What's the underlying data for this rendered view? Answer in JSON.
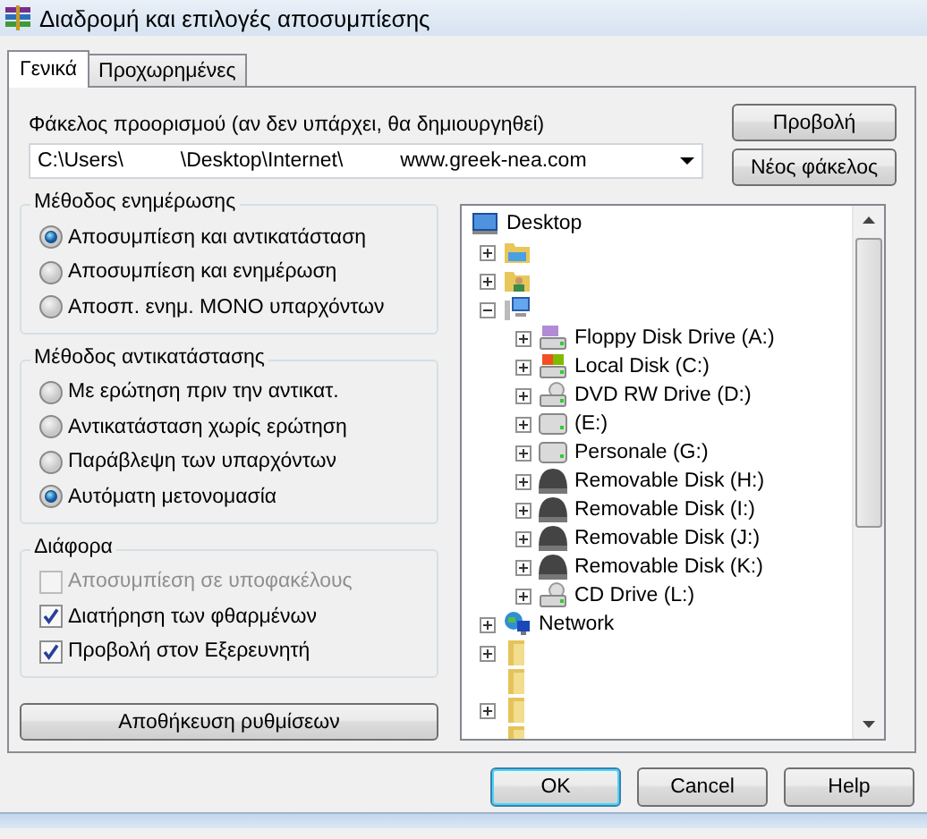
{
  "window": {
    "title": "Διαδρομή και επιλογές αποσυμπίεσης"
  },
  "tabs": [
    {
      "label": "Γενικά",
      "selected": true
    },
    {
      "label": "Προχωρημένες",
      "selected": false
    }
  ],
  "destination": {
    "label": "Φάκελος προορισμού (αν δεν υπάρχει, θα δημιουργηθεί)",
    "value": "C:\\Users\\          \\Desktop\\Internet\\          www.greek-nea.com"
  },
  "side_buttons": [
    "Προβολή",
    "Νέος φάκελος"
  ],
  "groups": [
    {
      "title": "Μέθοδος ενημέρωσης",
      "kind": "radio",
      "items": [
        {
          "label": "Αποσυμπίεση και αντικατάσταση",
          "selected": true
        },
        {
          "label": "Αποσυμπίεση και ενημέρωση",
          "selected": false
        },
        {
          "label": "Αποσπ. ενημ. ΜΟΝΟ υπαρχόντων",
          "selected": false
        }
      ]
    },
    {
      "title": "Μέθοδος αντικατάστασης",
      "kind": "radio",
      "items": [
        {
          "label": "Με ερώτηση πριν την αντικατ.",
          "selected": false
        },
        {
          "label": "Αντικατάσταση χωρίς ερώτηση",
          "selected": false
        },
        {
          "label": "Παράβλεψη των υπαρχόντων",
          "selected": false
        },
        {
          "label": "Αυτόματη μετονομασία",
          "selected": true
        }
      ]
    },
    {
      "title": "Διάφορα",
      "kind": "checkbox",
      "items": [
        {
          "label": "Αποσυμπίεση σε υποφακέλους",
          "checked": false,
          "disabled": true
        },
        {
          "label": "Διατήρηση των φθαρμένων",
          "checked": true,
          "disabled": false
        },
        {
          "label": "Προβολή στον Εξερευνητή",
          "checked": true,
          "disabled": false
        }
      ]
    }
  ],
  "save_button": "Αποθήκευση ρυθμίσεων",
  "tree": [
    {
      "label": "Desktop",
      "kind": "desktop",
      "children": [
        {
          "kind": "library",
          "expanded": false
        },
        {
          "kind": "user",
          "expanded": false
        },
        {
          "kind": "computer",
          "expanded": true,
          "children": [
            {
              "label": "Floppy Disk Drive (A:)",
              "kind": "floppy",
              "expanded": false
            },
            {
              "label": "Local Disk (C:)",
              "kind": "system-drive",
              "expanded": false
            },
            {
              "label": "DVD RW Drive (D:)",
              "kind": "dvd",
              "expanded": false
            },
            {
              "label": "(E:)",
              "kind": "drive",
              "expanded": false
            },
            {
              "label": "Personale (G:)",
              "kind": "drive",
              "expanded": false
            },
            {
              "label": "Removable Disk (H:)",
              "kind": "removable",
              "expanded": false
            },
            {
              "label": "Removable Disk (I:)",
              "kind": "removable",
              "expanded": false
            },
            {
              "label": "Removable Disk (J:)",
              "kind": "removable",
              "expanded": false
            },
            {
              "label": "Removable Disk (K:)",
              "kind": "removable",
              "expanded": false
            },
            {
              "label": "CD Drive (L:)",
              "kind": "dvd",
              "expanded": false
            }
          ]
        },
        {
          "label": "Network",
          "kind": "network",
          "expanded": false
        },
        {
          "kind": "folder",
          "expanded": false
        },
        {
          "kind": "folder"
        },
        {
          "kind": "folder",
          "expanded": false
        },
        {
          "kind": "folder"
        }
      ]
    }
  ],
  "buttons": [
    {
      "label": "OK",
      "default": true
    },
    {
      "label": "Cancel",
      "default": false
    },
    {
      "label": "Help",
      "default": false
    }
  ]
}
